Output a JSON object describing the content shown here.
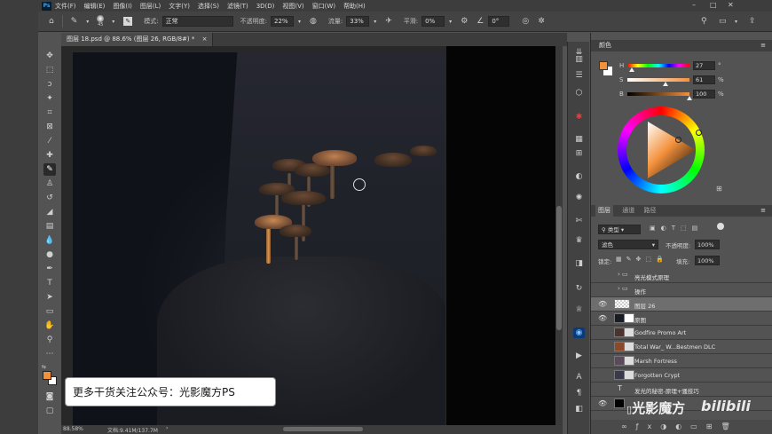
{
  "menubar": {
    "items": [
      "文件(F)",
      "编辑(E)",
      "图像(I)",
      "图层(L)",
      "文字(Y)",
      "选择(S)",
      "滤镜(T)",
      "3D(D)",
      "视图(V)",
      "窗口(W)",
      "帮助(H)"
    ]
  },
  "options": {
    "brush_size": "45",
    "mode_label": "模式:",
    "mode_value": "正常",
    "opacity_label": "不透明度:",
    "opacity_value": "22%",
    "flow_label": "流量:",
    "flow_value": "33%",
    "smooth_label": "平滑:",
    "smooth_value": "0%",
    "angle_value": "0°"
  },
  "document": {
    "tab_title": "图层 18.psd @ 88.6% (图层 26, RGB/8#) *",
    "zoom": "88.58%",
    "doc_info": "文档:9.41M/137.7M"
  },
  "toast_text": "更多干货关注公众号：光影魔方PS",
  "color_panel": {
    "title": "颜色",
    "h_label": "H",
    "h_value": "27",
    "h_unit": "°",
    "s_label": "S",
    "s_value": "61",
    "s_unit": "%",
    "b_label": "B",
    "b_value": "100",
    "b_unit": "%",
    "h_fraction": 0.075,
    "s_fraction": 0.61,
    "b_fraction": 1.0,
    "foreground": "#f3913b",
    "background": "#ffffff"
  },
  "layers_panel": {
    "tabs": [
      "图层",
      "通道",
      "路径"
    ],
    "filter_kind": "类型",
    "blend_mode": "滤色",
    "opacity_label": "不透明度:",
    "opacity_value": "100%",
    "lock_label": "锁定:",
    "fill_label": "填充:",
    "fill_value": "100%",
    "layers": [
      {
        "name": "亮光模式原理",
        "type": "group",
        "visible": false
      },
      {
        "name": "操作",
        "type": "group",
        "visible": false
      },
      {
        "name": "图层 26",
        "type": "layer",
        "visible": true,
        "selected": true
      },
      {
        "name": "原图",
        "type": "layer",
        "visible": true
      },
      {
        "name": "Godfire Promo Art",
        "type": "layer",
        "visible": false
      },
      {
        "name": "Total War_ W...Bestmen DLC",
        "type": "layer",
        "visible": false
      },
      {
        "name": "Marsh Fortress",
        "type": "layer",
        "visible": false
      },
      {
        "name": "Forgotten Crypt",
        "type": "layer",
        "visible": false
      },
      {
        "name": "发光的秘密-原理+骚技巧",
        "type": "text",
        "visible": false
      },
      {
        "name": "",
        "type": "layer",
        "visible": true
      }
    ]
  },
  "watermark": {
    "channel": "光影魔方",
    "site": "bilibili"
  }
}
